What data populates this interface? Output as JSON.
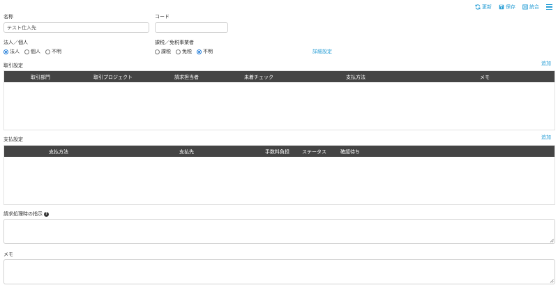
{
  "toolbar": {
    "update_label": "更新",
    "save_label": "保存",
    "merge_label": "統合"
  },
  "form": {
    "name": {
      "label": "名称",
      "value": "テスト仕入先"
    },
    "code": {
      "label": "コード",
      "value": ""
    },
    "entity_type": {
      "label": "法人／個人",
      "options": [
        "法人",
        "個人",
        "不明"
      ],
      "selected": "法人"
    },
    "tax_status": {
      "label": "課税／免税事業者",
      "options": [
        "課税",
        "免税",
        "不明"
      ],
      "selected": "不明"
    },
    "detail_link": "詳細設定"
  },
  "transaction_settings": {
    "title": "取引設定",
    "add_label": "追加",
    "columns": [
      "取引部門",
      "取引プロジェクト",
      "請求担当者",
      "未着チェック",
      "支払方法",
      "メモ"
    ],
    "rows": []
  },
  "payment_settings": {
    "title": "支払設定",
    "add_label": "追加",
    "columns": [
      "支払方法",
      "支払先",
      "手数料負担",
      "ステータス",
      "確認待ち"
    ],
    "rows": []
  },
  "billing_instructions": {
    "label": "請求処理時の指示",
    "value": ""
  },
  "memo": {
    "label": "メモ",
    "value": ""
  }
}
